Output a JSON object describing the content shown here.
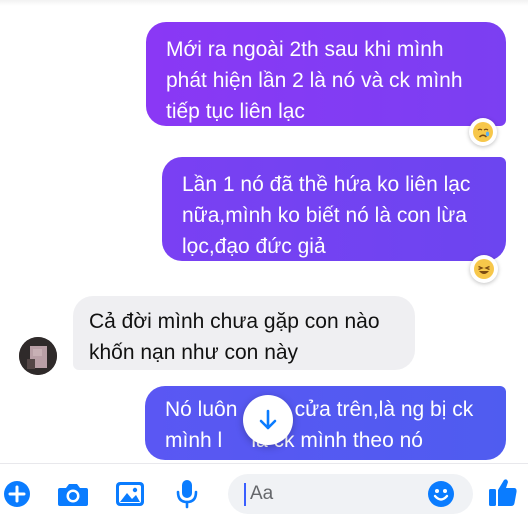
{
  "messages": [
    {
      "direction": "outgoing",
      "text": "Mới ra ngoài 2th sau khi mình phát hiện lần 2 là nó và ck mình tiếp tục liên lạc",
      "reaction": "crying-emoji"
    },
    {
      "direction": "outgoing",
      "text": "Lần 1 nó đã thề hứa ko liên lạc nữa,mình ko biết nó là con lừa lọc,đạo đức giả",
      "reaction": "laughing-emoji"
    },
    {
      "direction": "incoming",
      "text": "Cả đời mình chưa gặp con nào khốn nạn như con này"
    },
    {
      "direction": "outgoing",
      "text": "Nó luôn      là cửa trên,là ng bị ck mình l     là ck mình theo nó"
    }
  ],
  "composer": {
    "placeholder": "Aa",
    "icons": [
      "plus-icon",
      "camera-icon",
      "gallery-icon",
      "microphone-icon",
      "emoji-icon",
      "thumbs-up-icon"
    ],
    "accent_color": "#0a7cff"
  },
  "colors": {
    "outgoing_top": "#8a38f5",
    "outgoing_bottom": "#4f5cf0",
    "incoming_bg": "#efeff2"
  }
}
